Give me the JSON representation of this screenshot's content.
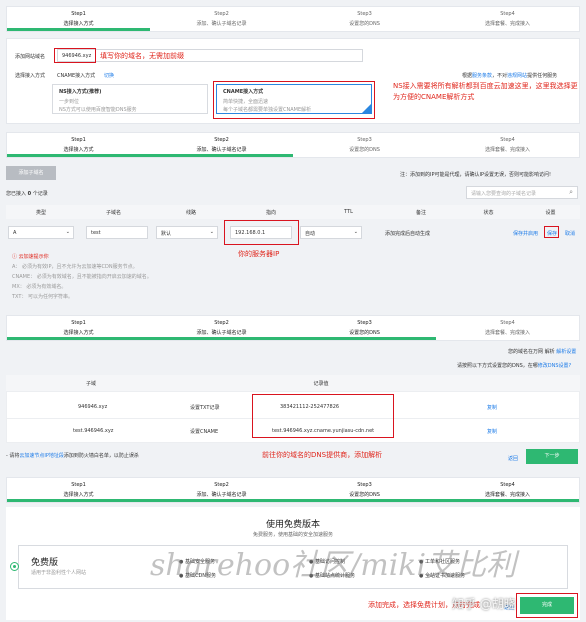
{
  "steps": [
    {
      "num": "Step1",
      "label": "选择接入方式"
    },
    {
      "num": "Step2",
      "label": "添加、确认子域名记录"
    },
    {
      "num": "Step3",
      "label": "设置您的DNS"
    },
    {
      "num": "Step4",
      "label": "选择套餐、完成接入"
    }
  ],
  "section1": {
    "add_domain_label": "添加网站域名",
    "domain_value": "946946.xyz",
    "annotation": "填写你的域名，无需加前缀",
    "access_label": "选择接入方式",
    "cname_label": "CNAME接入方式",
    "switch_link": "切换",
    "help_text": "根据",
    "help_link1": "服务条款",
    "help_mid": "，不对",
    "help_link2": "违规网站",
    "help_tail": "提供任何服务",
    "ns_title": "NS接入方式(推荐)",
    "ns_desc1": "一步到位",
    "ns_desc2": "NS方式可以使用百度智能DNS服务",
    "cname_title": "CNAME接入方式",
    "cname_desc1": "简单快捷，全面迅速",
    "cname_desc2": "每个子域名都需要单独设置CNAME解析",
    "red_note": "NS接入需要将所有解析都到百度云加速这里，这里我选择更为方便的CNAME解析方式"
  },
  "section2": {
    "add_sub_button": "添加子域名",
    "notice": "注：添加到的IP可能是代理，请确认IP设置无误，否则可能影响访问!",
    "count_text": "您已接入",
    "count_num": "0",
    "count_unit": "个记录",
    "search_placeholder": "请输入您要查询的子域名记录",
    "headers": [
      "类型",
      "子域名",
      "线路",
      "指向",
      "TTL",
      "备注",
      "状态",
      "设置"
    ],
    "row": {
      "type": "A",
      "subdomain": "test",
      "line": "默认",
      "target": "192.168.0.1",
      "ttl": "自动",
      "remark": "添加完成后自动生成",
      "save_enable": "保存并启用",
      "save": "保存",
      "cancel": "取消"
    },
    "annotation": "你的服务器IP",
    "tips_title": "云加速提示你",
    "tips": [
      "A：  必须为有效IP，且不允许为云加速等CDN服务节点。",
      "CNAME：  必须为有效域名，且不能被指向开启云加速的域名。",
      "MX：  必须为有效域名。",
      "TXT：  可以为任何字符串。"
    ]
  },
  "section3": {
    "line1_pre": "您的域名在万网 解析",
    "line1_link": "解析设置",
    "line2": "请按照以下方式设置您的DNS，在哪",
    "line2_link": "修改DNS设置?",
    "headers": [
      "子域",
      "",
      "记录值",
      ""
    ],
    "rows": [
      {
        "sub": "946946.xyz",
        "type": "设置TXT记录",
        "value": "383421112-252477826",
        "action": "复制"
      },
      {
        "sub": "test.946946.xyz",
        "type": "设置CNAME",
        "value": "test.946946.xyz.cname.yunjiasu-cdn.net",
        "action": "复制"
      }
    ],
    "footer_note_pre": "- 请将",
    "footer_note_link": "云加速节点IP地址段",
    "footer_note_tail": "添加到防火墙白名单，以防止误杀",
    "annotation": "前往你的域名的DNS提供商，添加解析",
    "back_link": "返回",
    "next_button": "下一步"
  },
  "section4": {
    "title": "使用免费版本",
    "subtitle": "免费服务，使用基础的安全加速服务",
    "plan_name": "免费版",
    "plan_desc": "适用于非盈利性个人网站",
    "features": [
      "基础安全服务",
      "基础CDN服务",
      "基础访问控制",
      "基础站点统计服务",
      "工单和社区服务",
      "全站证书加速服务"
    ],
    "complete_button": "完成",
    "back_link": "返回",
    "annotation": "添加完成，选择免费计划，点击完成"
  },
  "watermark": {
    "main": "sharehoo社区/miki艾比利",
    "zhihu": "知乎 @胡晓"
  },
  "colors": {
    "accent": "#2eb872",
    "red": "#e0261c",
    "link": "#1c7be8"
  }
}
